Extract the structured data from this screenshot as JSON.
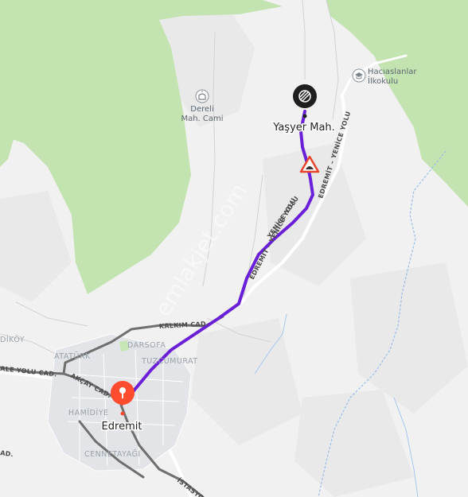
{
  "map": {
    "places": {
      "yasyer": "Yaşyer Mah.",
      "edremit": "Edremit",
      "dereli": "Dereli",
      "dereli_cami": "Mah. Cami",
      "haciaslanlar": "Hacıaslanlar",
      "ilkokulu": "İlkokulu"
    },
    "districts": {
      "ataturk": "ATATÜRK",
      "darsofa": "DARSOFA",
      "tuzcumurat": "TUZCUMURAT",
      "hamidiye": "HAMİDİYE",
      "cennetayagi": "CENNETAYAĞI",
      "koy": "DİKÖY"
    },
    "roads": {
      "yenice_upper": "YENİCE YOLU",
      "edremit_yenice": "EDREMİT – YENİCE YOLU",
      "edremit_yenice_2": "EDREMİT – YENİCE YOLU",
      "kalkim": "KALKIM CAD.",
      "akcay": "AKÇAY CAD.",
      "ale_yolu": "ALE YOLU CAD.",
      "istasyon": "İSTASYO",
      "ad_left": "AD."
    },
    "watermark": "emlakjet.com",
    "colors": {
      "route": "#6a1fd8",
      "forest": "#c5e5b4",
      "road_dark": "#6c6c6c",
      "road_light": "#ffffff",
      "pin_start": "#ff4b2e",
      "pin_end": "#222222",
      "river": "#8fb6e6"
    },
    "icons": {
      "start": "location-pin-icon",
      "end": "destination-flag-icon",
      "warning": "speed-bump-warning-icon",
      "mosque": "mosque-icon",
      "school": "school-icon"
    }
  }
}
